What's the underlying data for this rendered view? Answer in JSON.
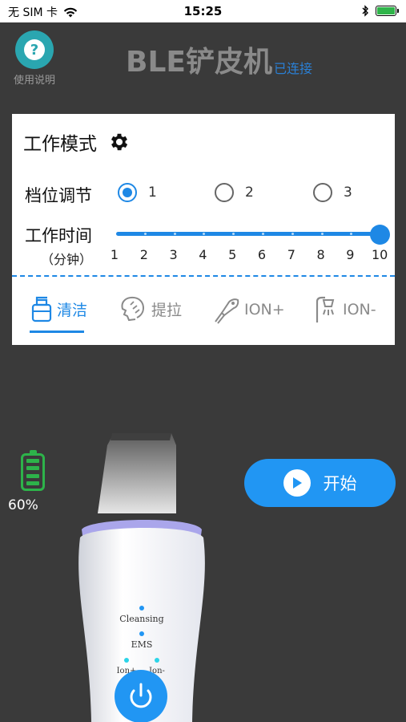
{
  "status_bar": {
    "carrier": "无 SIM 卡",
    "time": "15:25",
    "icons": [
      "wifi-icon",
      "bluetooth-icon",
      "battery-charging-icon"
    ]
  },
  "header": {
    "help_label": "使用说明",
    "help_symbol": "?",
    "title": "BLE铲皮机",
    "connection_status": "已连接"
  },
  "card": {
    "mode_title": "工作模式",
    "level": {
      "label": "档位调节",
      "options": [
        "1",
        "2",
        "3"
      ],
      "selected": "1"
    },
    "work_time": {
      "label": "工作时间",
      "unit_label": "（分钟）",
      "ticks": [
        "1",
        "2",
        "3",
        "4",
        "5",
        "6",
        "7",
        "8",
        "9",
        "10"
      ],
      "value": 10
    },
    "tabs": [
      {
        "label": "清洁",
        "icon": "bottle-icon",
        "active": true
      },
      {
        "label": "提拉",
        "icon": "face-lift-icon",
        "active": false
      },
      {
        "label": "ION+",
        "icon": "massager-icon",
        "active": false
      },
      {
        "label": "ION-",
        "icon": "shower-icon",
        "active": false
      }
    ]
  },
  "device_status": {
    "battery_percent": "60%",
    "battery_level": 0.6
  },
  "start_button": {
    "label": "开始"
  },
  "device_image": {
    "labels": [
      "Cleansing",
      "EMS",
      "Ion+",
      "Ion-"
    ]
  },
  "colors": {
    "accent": "#1e88e5",
    "background": "#3a3a3a",
    "battery": "#2db34a",
    "help": "#2aa6b0"
  }
}
